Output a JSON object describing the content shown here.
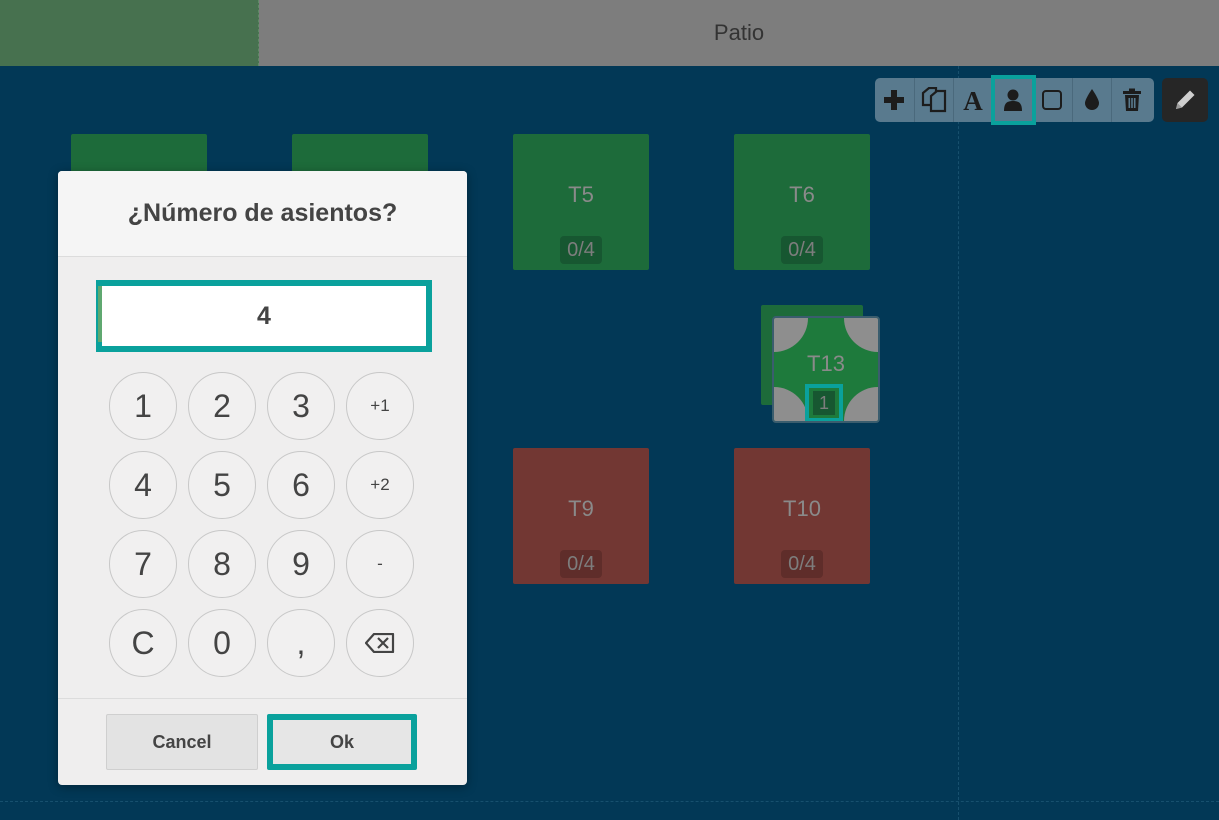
{
  "floors": {
    "tab_left": "",
    "tab_right": "Patio"
  },
  "toolbar": {
    "icons": [
      "plus-icon",
      "copy-icon",
      "text-icon",
      "person-icon",
      "square-icon",
      "drop-icon",
      "trash-icon"
    ],
    "active": "person-icon",
    "edit_icon": "pencil-icon"
  },
  "tables": {
    "t5": {
      "name": "T5",
      "seats": "0/4",
      "status": "free"
    },
    "t6": {
      "name": "T6",
      "seats": "0/4",
      "status": "free"
    },
    "t9": {
      "name": "T9",
      "seats": "0/4",
      "status": "occupied"
    },
    "t10": {
      "name": "T10",
      "seats": "0/4",
      "status": "occupied"
    },
    "t13": {
      "name": "T13",
      "seats": "1",
      "status": "selected"
    }
  },
  "modal": {
    "title": "¿Número de asientos?",
    "value": "4",
    "keys": [
      [
        "1",
        "2",
        "3",
        "+1"
      ],
      [
        "4",
        "5",
        "6",
        "+2"
      ],
      [
        "7",
        "8",
        "9",
        "-"
      ],
      [
        "C",
        "0",
        ",",
        "⌫"
      ]
    ],
    "cancel_label": "Cancel",
    "ok_label": "Ok"
  },
  "colors": {
    "background": "#023856",
    "accent": "#0aa19c",
    "table_free": "#1d6b3a",
    "table_occupied": "#723733"
  }
}
